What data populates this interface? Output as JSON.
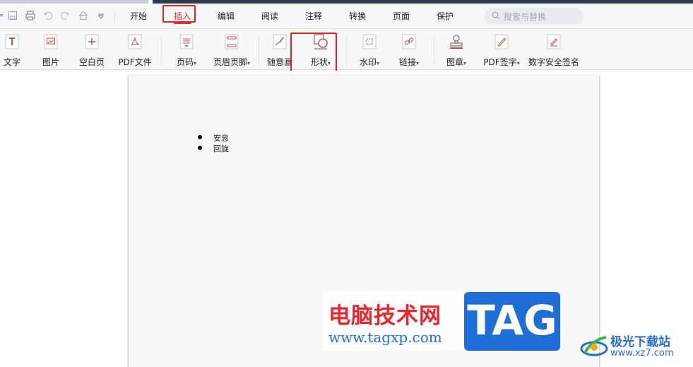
{
  "menubar": {
    "tabs": [
      {
        "label": "开始"
      },
      {
        "label": "插入"
      },
      {
        "label": "编辑"
      },
      {
        "label": "阅读"
      },
      {
        "label": "注释"
      },
      {
        "label": "转换"
      },
      {
        "label": "页面"
      },
      {
        "label": "保护"
      }
    ],
    "active_tab": "插入",
    "search_placeholder": "搜索与替换"
  },
  "toolbar": {
    "items": [
      {
        "label": "文字",
        "icon": "text-t-icon"
      },
      {
        "label": "图片",
        "icon": "image-icon"
      },
      {
        "label": "空白页",
        "icon": "blank-page-icon"
      },
      {
        "label": "PDF文件",
        "icon": "pdf-file-icon"
      },
      {
        "label": "页码",
        "icon": "page-number-icon",
        "dropdown": true
      },
      {
        "label": "页眉页脚",
        "icon": "header-footer-icon",
        "dropdown": true
      },
      {
        "label": "随意画",
        "icon": "freehand-icon"
      },
      {
        "label": "形状",
        "icon": "shape-icon",
        "dropdown": true
      },
      {
        "label": "水印",
        "icon": "watermark-icon",
        "dropdown": true
      },
      {
        "label": "链接",
        "icon": "link-icon",
        "dropdown": true
      },
      {
        "label": "图章",
        "icon": "stamp-icon",
        "dropdown": true
      },
      {
        "label": "PDF签字",
        "icon": "pdf-sign-icon",
        "dropdown": true
      },
      {
        "label": "数字安全签名",
        "icon": "digital-signature-icon"
      }
    ],
    "dropdown_glyph": "▾"
  },
  "document": {
    "bullets": [
      "安息",
      "回旋"
    ]
  },
  "watermark": {
    "brand_cn": "电脑技术网",
    "brand_url": "www.tagxp.com",
    "brand_tag": "TAG",
    "site2_name": "极光下载站",
    "site2_url": "www.xz7.com"
  },
  "colors": {
    "accent_red": "#e12424",
    "icon_red": "#d04a4a",
    "tag_blue": "#1f6ed8",
    "page_bg": "#f8f8f8"
  }
}
